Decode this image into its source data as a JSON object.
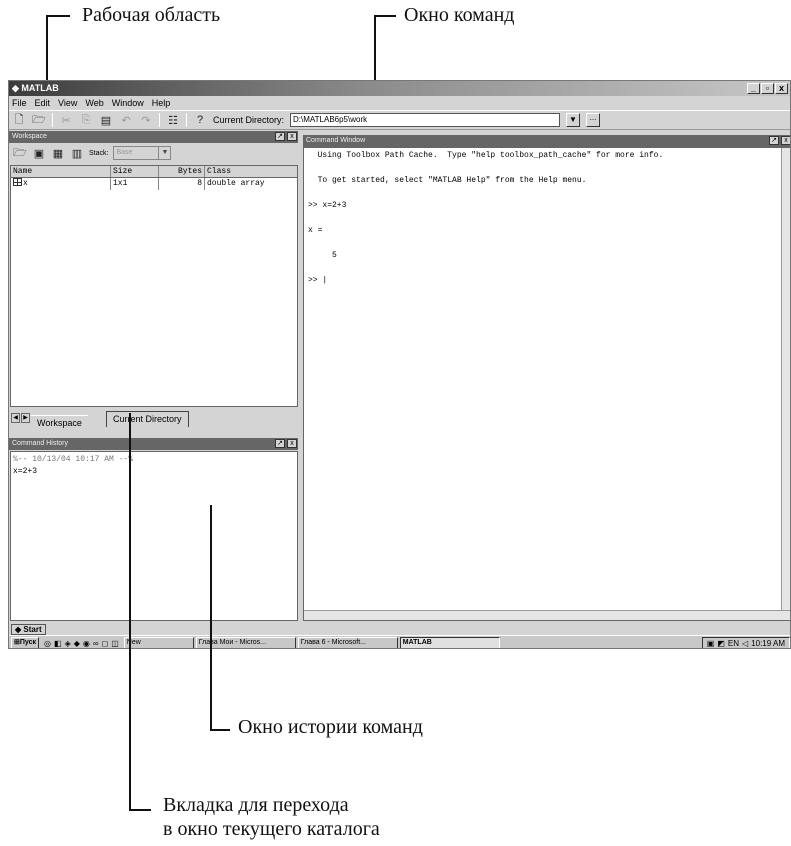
{
  "annotations": {
    "workspace": "Рабочая область",
    "command_window": "Окно команд",
    "command_history": "Окно истории команд",
    "current_dir_tab_line1": "Вкладка для перехода",
    "current_dir_tab_line2": "в окно текущего каталога"
  },
  "window": {
    "title": "MATLAB",
    "controls": [
      "_",
      "▫",
      "x"
    ]
  },
  "menu": [
    "File",
    "Edit",
    "View",
    "Web",
    "Window",
    "Help"
  ],
  "toolbar": {
    "current_dir_label": "Current Directory:",
    "current_dir_value": "D:\\MATLAB6p5\\work"
  },
  "workspace": {
    "title": "Workspace",
    "stack_label": "Stack:",
    "stack_value": "Base",
    "columns": [
      "Name",
      "Size",
      "Bytes",
      "Class"
    ],
    "rows": [
      {
        "name": "x",
        "size": "1x1",
        "bytes": "8",
        "class": "double array"
      }
    ],
    "tabs": [
      "Workspace",
      "Current Directory"
    ]
  },
  "command_history": {
    "title": "Command History",
    "lines": [
      "%-- 10/13/04 10:17 AM --%",
      "x=2+3"
    ]
  },
  "command_window": {
    "title": "Command Window",
    "lines": [
      "  Using Toolbox Path Cache.  Type \"help toolbox_path_cache\" for more info.",
      "  To get started, select \"MATLAB Help\" from the Help menu.",
      ">> x=2+3",
      "x =",
      "     5",
      ">> |"
    ]
  },
  "start_button": "Start",
  "taskbar": {
    "start": "Пуск",
    "tasks": [
      "New",
      "Глава Мои - Micros...",
      "Глава 6 - Microsoft...",
      "MATLAB"
    ],
    "clock": "10:19 AM",
    "lang": "EN"
  },
  "icons": [
    "matlab-logo-icon",
    "new-file-icon",
    "open-file-icon",
    "cut-icon",
    "copy-icon",
    "paste-icon",
    "undo-icon",
    "redo-icon",
    "simulink-icon",
    "help-icon",
    "grid-icon"
  ]
}
